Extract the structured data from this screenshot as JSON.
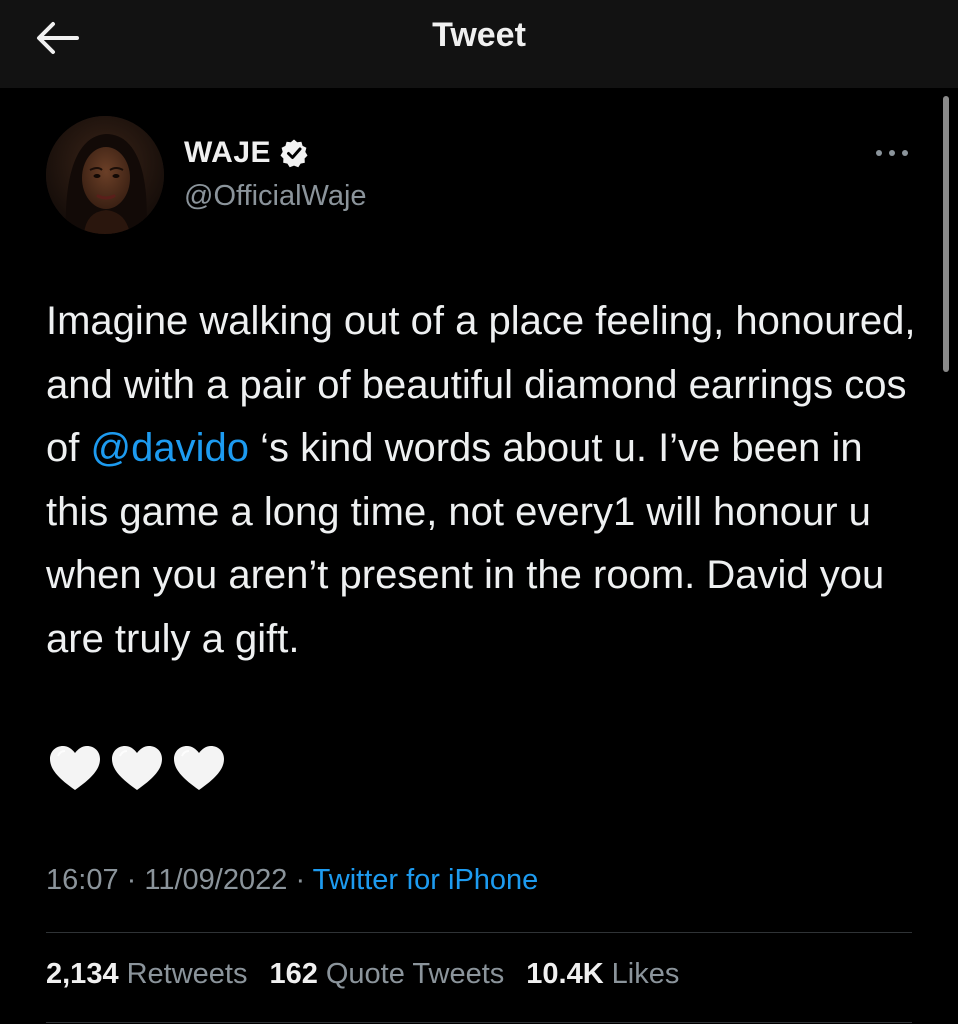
{
  "header": {
    "title": "Tweet",
    "back_icon": "arrow-left-icon"
  },
  "tweet": {
    "author": {
      "name": "WAJE",
      "verified_icon": "verified-badge-icon",
      "handle": "@OfficialWaje"
    },
    "more_icon": "more-horizontal-icon",
    "text_before_mention": "Imagine walking out of a place feeling, honoured, and with a pair of beautiful diamond earrings cos of ",
    "mention": "@davido",
    "text_after_mention": " ‘s kind words about u. I’ve been in this game a long time, not every1 will honour u when you aren’t present in the room. David you are truly a gift.",
    "emojis": [
      "white-heart-icon",
      "white-heart-icon",
      "white-heart-icon"
    ],
    "time": "16:07",
    "separator": "·",
    "date": "11/09/2022",
    "source": "Twitter for iPhone"
  },
  "stats": {
    "retweets_count": "2,134",
    "retweets_label": "Retweets",
    "quotes_count": "162",
    "quotes_label": "Quote Tweets",
    "likes_count": "10.4K",
    "likes_label": "Likes"
  },
  "colors": {
    "background": "#000000",
    "header_background": "#121212",
    "text_primary": "#e7e9ea",
    "text_secondary": "#8b949b",
    "link": "#1d9bf0",
    "divider": "#2f3336"
  }
}
